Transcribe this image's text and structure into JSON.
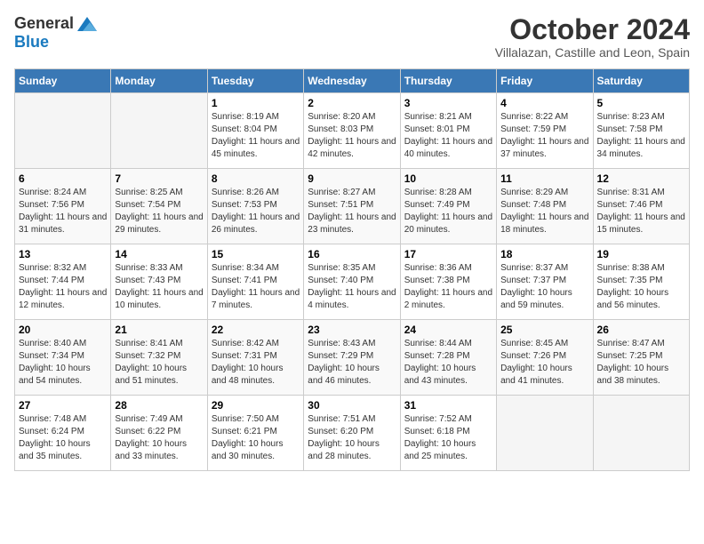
{
  "header": {
    "logo_general": "General",
    "logo_blue": "Blue",
    "month_title": "October 2024",
    "subtitle": "Villalazan, Castille and Leon, Spain"
  },
  "days_of_week": [
    "Sunday",
    "Monday",
    "Tuesday",
    "Wednesday",
    "Thursday",
    "Friday",
    "Saturday"
  ],
  "weeks": [
    [
      {
        "day": "",
        "empty": true
      },
      {
        "day": "",
        "empty": true
      },
      {
        "day": "1",
        "sunrise": "Sunrise: 8:19 AM",
        "sunset": "Sunset: 8:04 PM",
        "daylight": "Daylight: 11 hours and 45 minutes."
      },
      {
        "day": "2",
        "sunrise": "Sunrise: 8:20 AM",
        "sunset": "Sunset: 8:03 PM",
        "daylight": "Daylight: 11 hours and 42 minutes."
      },
      {
        "day": "3",
        "sunrise": "Sunrise: 8:21 AM",
        "sunset": "Sunset: 8:01 PM",
        "daylight": "Daylight: 11 hours and 40 minutes."
      },
      {
        "day": "4",
        "sunrise": "Sunrise: 8:22 AM",
        "sunset": "Sunset: 7:59 PM",
        "daylight": "Daylight: 11 hours and 37 minutes."
      },
      {
        "day": "5",
        "sunrise": "Sunrise: 8:23 AM",
        "sunset": "Sunset: 7:58 PM",
        "daylight": "Daylight: 11 hours and 34 minutes."
      }
    ],
    [
      {
        "day": "6",
        "sunrise": "Sunrise: 8:24 AM",
        "sunset": "Sunset: 7:56 PM",
        "daylight": "Daylight: 11 hours and 31 minutes."
      },
      {
        "day": "7",
        "sunrise": "Sunrise: 8:25 AM",
        "sunset": "Sunset: 7:54 PM",
        "daylight": "Daylight: 11 hours and 29 minutes."
      },
      {
        "day": "8",
        "sunrise": "Sunrise: 8:26 AM",
        "sunset": "Sunset: 7:53 PM",
        "daylight": "Daylight: 11 hours and 26 minutes."
      },
      {
        "day": "9",
        "sunrise": "Sunrise: 8:27 AM",
        "sunset": "Sunset: 7:51 PM",
        "daylight": "Daylight: 11 hours and 23 minutes."
      },
      {
        "day": "10",
        "sunrise": "Sunrise: 8:28 AM",
        "sunset": "Sunset: 7:49 PM",
        "daylight": "Daylight: 11 hours and 20 minutes."
      },
      {
        "day": "11",
        "sunrise": "Sunrise: 8:29 AM",
        "sunset": "Sunset: 7:48 PM",
        "daylight": "Daylight: 11 hours and 18 minutes."
      },
      {
        "day": "12",
        "sunrise": "Sunrise: 8:31 AM",
        "sunset": "Sunset: 7:46 PM",
        "daylight": "Daylight: 11 hours and 15 minutes."
      }
    ],
    [
      {
        "day": "13",
        "sunrise": "Sunrise: 8:32 AM",
        "sunset": "Sunset: 7:44 PM",
        "daylight": "Daylight: 11 hours and 12 minutes."
      },
      {
        "day": "14",
        "sunrise": "Sunrise: 8:33 AM",
        "sunset": "Sunset: 7:43 PM",
        "daylight": "Daylight: 11 hours and 10 minutes."
      },
      {
        "day": "15",
        "sunrise": "Sunrise: 8:34 AM",
        "sunset": "Sunset: 7:41 PM",
        "daylight": "Daylight: 11 hours and 7 minutes."
      },
      {
        "day": "16",
        "sunrise": "Sunrise: 8:35 AM",
        "sunset": "Sunset: 7:40 PM",
        "daylight": "Daylight: 11 hours and 4 minutes."
      },
      {
        "day": "17",
        "sunrise": "Sunrise: 8:36 AM",
        "sunset": "Sunset: 7:38 PM",
        "daylight": "Daylight: 11 hours and 2 minutes."
      },
      {
        "day": "18",
        "sunrise": "Sunrise: 8:37 AM",
        "sunset": "Sunset: 7:37 PM",
        "daylight": "Daylight: 10 hours and 59 minutes."
      },
      {
        "day": "19",
        "sunrise": "Sunrise: 8:38 AM",
        "sunset": "Sunset: 7:35 PM",
        "daylight": "Daylight: 10 hours and 56 minutes."
      }
    ],
    [
      {
        "day": "20",
        "sunrise": "Sunrise: 8:40 AM",
        "sunset": "Sunset: 7:34 PM",
        "daylight": "Daylight: 10 hours and 54 minutes."
      },
      {
        "day": "21",
        "sunrise": "Sunrise: 8:41 AM",
        "sunset": "Sunset: 7:32 PM",
        "daylight": "Daylight: 10 hours and 51 minutes."
      },
      {
        "day": "22",
        "sunrise": "Sunrise: 8:42 AM",
        "sunset": "Sunset: 7:31 PM",
        "daylight": "Daylight: 10 hours and 48 minutes."
      },
      {
        "day": "23",
        "sunrise": "Sunrise: 8:43 AM",
        "sunset": "Sunset: 7:29 PM",
        "daylight": "Daylight: 10 hours and 46 minutes."
      },
      {
        "day": "24",
        "sunrise": "Sunrise: 8:44 AM",
        "sunset": "Sunset: 7:28 PM",
        "daylight": "Daylight: 10 hours and 43 minutes."
      },
      {
        "day": "25",
        "sunrise": "Sunrise: 8:45 AM",
        "sunset": "Sunset: 7:26 PM",
        "daylight": "Daylight: 10 hours and 41 minutes."
      },
      {
        "day": "26",
        "sunrise": "Sunrise: 8:47 AM",
        "sunset": "Sunset: 7:25 PM",
        "daylight": "Daylight: 10 hours and 38 minutes."
      }
    ],
    [
      {
        "day": "27",
        "sunrise": "Sunrise: 7:48 AM",
        "sunset": "Sunset: 6:24 PM",
        "daylight": "Daylight: 10 hours and 35 minutes."
      },
      {
        "day": "28",
        "sunrise": "Sunrise: 7:49 AM",
        "sunset": "Sunset: 6:22 PM",
        "daylight": "Daylight: 10 hours and 33 minutes."
      },
      {
        "day": "29",
        "sunrise": "Sunrise: 7:50 AM",
        "sunset": "Sunset: 6:21 PM",
        "daylight": "Daylight: 10 hours and 30 minutes."
      },
      {
        "day": "30",
        "sunrise": "Sunrise: 7:51 AM",
        "sunset": "Sunset: 6:20 PM",
        "daylight": "Daylight: 10 hours and 28 minutes."
      },
      {
        "day": "31",
        "sunrise": "Sunrise: 7:52 AM",
        "sunset": "Sunset: 6:18 PM",
        "daylight": "Daylight: 10 hours and 25 minutes."
      },
      {
        "day": "",
        "empty": true
      },
      {
        "day": "",
        "empty": true
      }
    ]
  ]
}
